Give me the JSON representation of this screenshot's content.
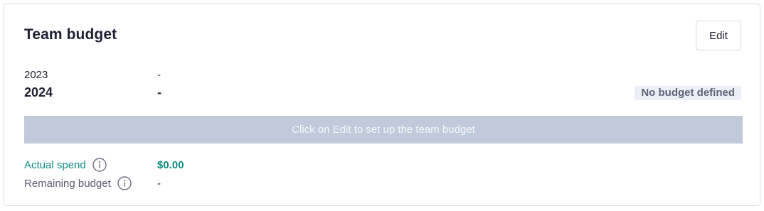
{
  "card": {
    "title": "Team budget",
    "edit_label": "Edit"
  },
  "years": [
    {
      "year": "2023",
      "value": "-"
    },
    {
      "year": "2024",
      "value": "-",
      "status": "No budget defined"
    }
  ],
  "bar": {
    "text": "Click on Edit to set up the team budget",
    "color": "#c1cadb"
  },
  "stats": {
    "actual_label": "Actual spend",
    "actual_value": "$0.00",
    "remaining_label": "Remaining budget",
    "remaining_value": "-"
  },
  "colors": {
    "accent": "#0e8c85",
    "badge_bg": "#eceff5"
  },
  "icons": [
    "info-icon"
  ]
}
